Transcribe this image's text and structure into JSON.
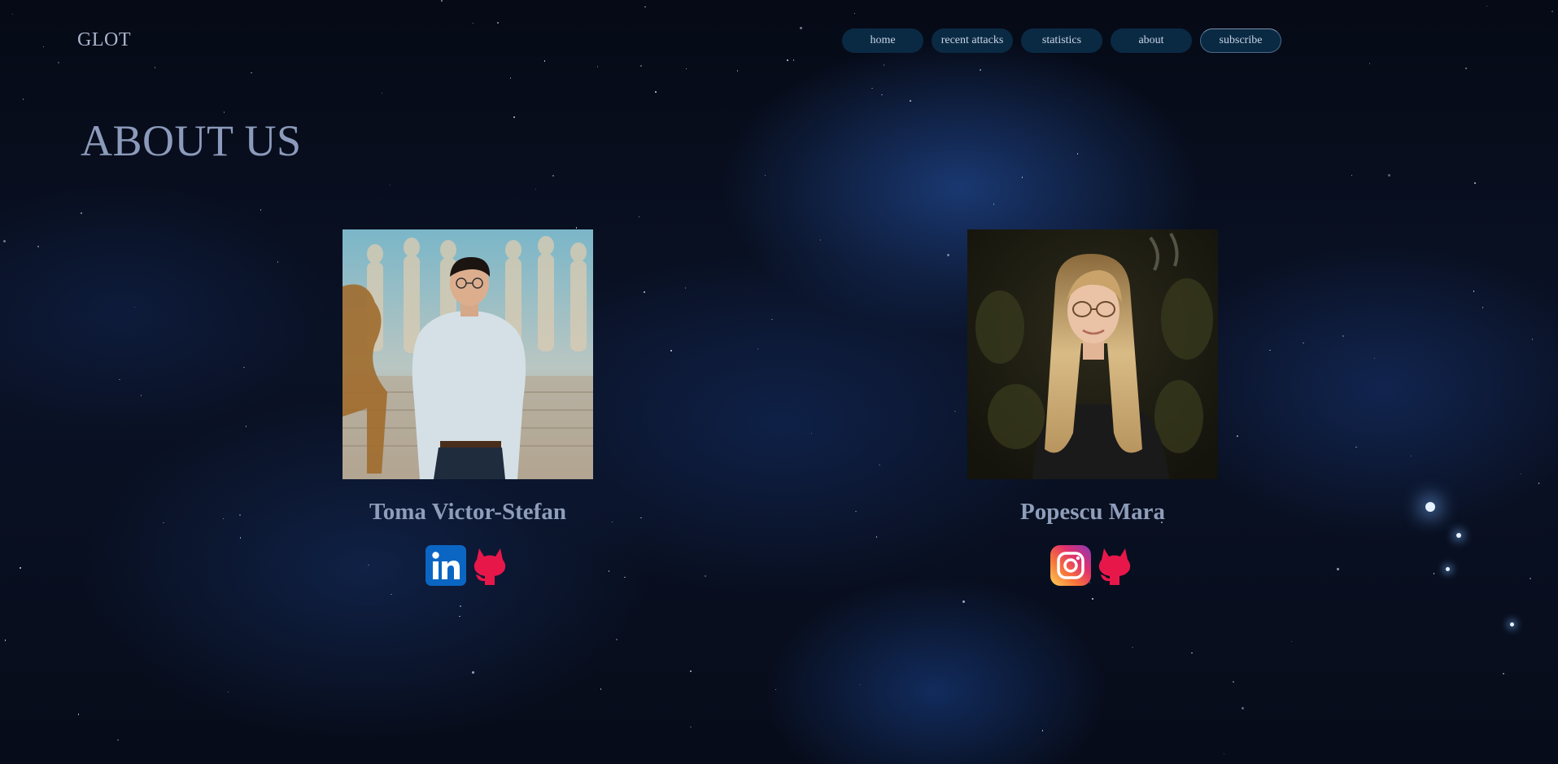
{
  "header": {
    "logo": "GLOT",
    "nav": [
      {
        "label": "home"
      },
      {
        "label": "recent attacks"
      },
      {
        "label": "statistics"
      },
      {
        "label": "about"
      },
      {
        "label": "subscribe"
      }
    ]
  },
  "main": {
    "title": "ABOUT US",
    "members": [
      {
        "name": "Toma Victor-Stefan",
        "photo": "portrait-photo",
        "socials": [
          {
            "icon": "linkedin-icon"
          },
          {
            "icon": "github-icon"
          }
        ]
      },
      {
        "name": "Popescu Mara",
        "photo": "portrait-photo",
        "socials": [
          {
            "icon": "instagram-icon"
          },
          {
            "icon": "github-icon"
          }
        ]
      }
    ]
  },
  "colors": {
    "nav_bg": "#0a2a44",
    "title": "#8c9bbb",
    "linkedin": "#0a66c2",
    "github": "#e8174a"
  }
}
